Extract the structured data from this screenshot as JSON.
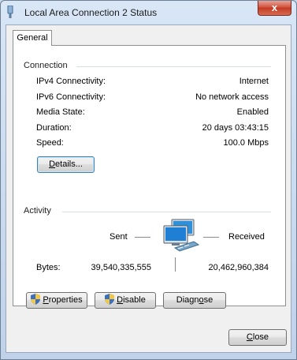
{
  "window": {
    "title": "Local Area Connection 2 Status",
    "close_glyph": "x"
  },
  "tabs": [
    {
      "label": "General",
      "selected": true
    }
  ],
  "connection": {
    "heading": "Connection",
    "rows": [
      {
        "label": "IPv4 Connectivity:",
        "value": "Internet"
      },
      {
        "label": "IPv6 Connectivity:",
        "value": "No network access"
      },
      {
        "label": "Media State:",
        "value": "Enabled"
      },
      {
        "label": "Duration:",
        "value": "20 days 03:43:15"
      },
      {
        "label": "Speed:",
        "value": "100.0 Mbps"
      }
    ],
    "details_button": {
      "accel": "D",
      "rest": "etails..."
    }
  },
  "activity": {
    "heading": "Activity",
    "sent_label": "Sent",
    "received_label": "Received",
    "bytes_label": "Bytes:",
    "bytes_sent": "39,540,335,555",
    "bytes_received": "20,462,960,384",
    "icon": "network-computers-icon"
  },
  "buttons": {
    "properties": {
      "accel": "P",
      "rest": "roperties",
      "icon": "uac-shield-icon"
    },
    "disable": {
      "accel": "D",
      "rest": "isable",
      "icon": "uac-shield-icon"
    },
    "diagnose": {
      "prefix": "Diagn",
      "accel": "o",
      "rest": "se"
    },
    "close": {
      "accel": "C",
      "rest": "lose"
    }
  },
  "colors": {
    "titlebar": "#c9d9ec",
    "close_button": "#c7432a",
    "panel": "#ffffff"
  }
}
